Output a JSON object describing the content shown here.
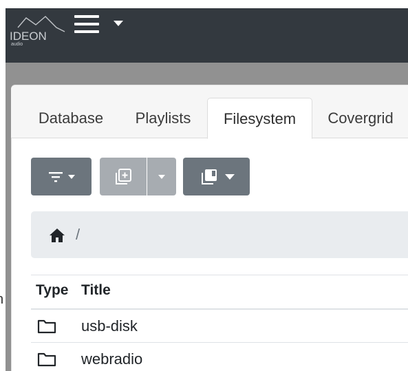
{
  "app": {
    "logo_text": "IDEON",
    "logo_subtext": "audio",
    "menu_icon": "hamburger-icon",
    "menu_caret_icon": "caret-down-icon"
  },
  "tabs": [
    {
      "label": "Database",
      "active": false
    },
    {
      "label": "Playlists",
      "active": false
    },
    {
      "label": "Filesystem",
      "active": true
    },
    {
      "label": "Covergrid",
      "active": false
    }
  ],
  "toolbar": {
    "filter_icon": "filter-icon",
    "add_icon": "add-to-playlist-icon",
    "add_disabled": true,
    "browse_icon": "library-icon"
  },
  "breadcrumb": {
    "home_icon": "home-icon",
    "separator": "/"
  },
  "table": {
    "columns": [
      "Type",
      "Title"
    ],
    "rows": [
      {
        "type_icon": "folder-icon",
        "title": "usb-disk"
      },
      {
        "type_icon": "folder-icon",
        "title": "webradio"
      }
    ]
  },
  "offscreen_peek_char": "n",
  "colors": {
    "navbar": "#33393f",
    "backdrop": "#919191",
    "button": "#6c757d",
    "button_disabled": "#a7acb1",
    "breadcrumb_bg": "#e9ecef"
  }
}
